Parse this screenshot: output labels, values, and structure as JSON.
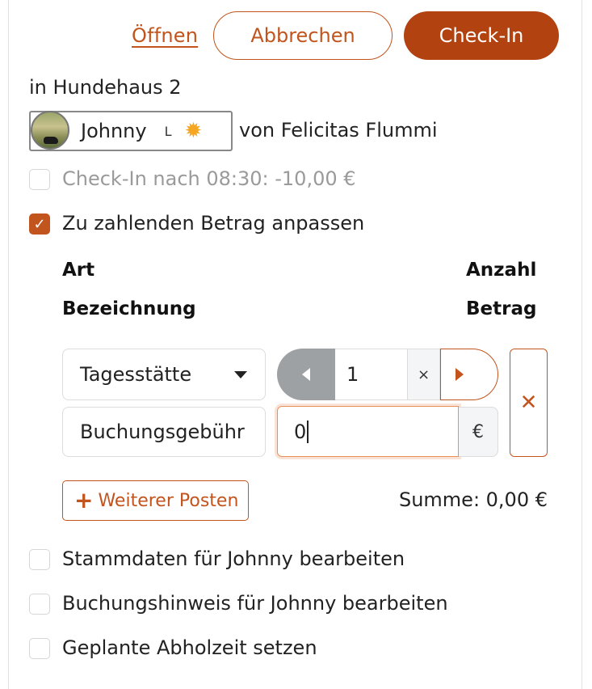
{
  "actions": {
    "open_label": "Öffnen",
    "cancel_label": "Abbrechen",
    "checkin_label": "Check-In"
  },
  "location": "in Hundehaus 2",
  "dog": {
    "name": "Johnny",
    "size_badge": "L",
    "status_icon": "sun-icon",
    "owner_text": "von Felicitas Flummi"
  },
  "late_checkin": {
    "label": "Check-In nach 08:30: -10,00 €",
    "checked": false,
    "disabled": true
  },
  "adjust_amount": {
    "label": "Zu zahlenden Betrag anpassen",
    "checked": true
  },
  "table": {
    "col_type": "Art",
    "col_count": "Anzahl",
    "col_desc": "Bezeichnung",
    "col_amount": "Betrag"
  },
  "line_item": {
    "type_value": "Tagesstätte",
    "count_value": "1",
    "multiply_symbol": "×",
    "description_value": "Buchungsgebühr",
    "amount_value": "0",
    "currency": "€",
    "remove_symbol": "✕"
  },
  "add_item_label": "Weiterer Posten",
  "sum_label": "Summe: 0,00 €",
  "options": [
    {
      "label": "Stammdaten für Johnny bearbeiten",
      "checked": false
    },
    {
      "label": "Buchungshinweis für Johnny bearbeiten",
      "checked": false
    },
    {
      "label": "Geplante Abholzeit setzen",
      "checked": false
    }
  ],
  "colors": {
    "accent": "#c2541d",
    "primary_button": "#b2420f",
    "stepper_disabled": "#9ea1a4"
  }
}
